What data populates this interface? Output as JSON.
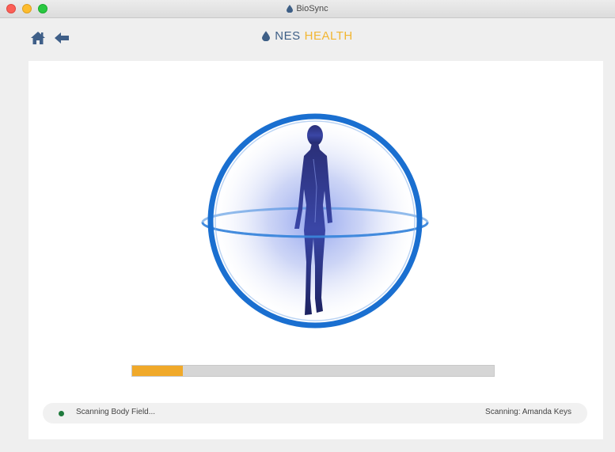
{
  "window": {
    "title": "BioSync"
  },
  "toolbar": {
    "brand_nes": "NES",
    "brand_health": "HEALTH",
    "home_icon": "home-icon",
    "back_icon": "back-arrow-icon"
  },
  "scan": {
    "progress": 0.14,
    "status_text": "Scanning Body Field...",
    "subject_label": "Scanning: Amanda Keys"
  },
  "colors": {
    "accent_blue": "#1e6fd1",
    "brand_blue": "#3e5f86",
    "brand_gold": "#f2b632",
    "progress_fill": "#f0a92a",
    "status_ok": "#1f7a3d"
  }
}
